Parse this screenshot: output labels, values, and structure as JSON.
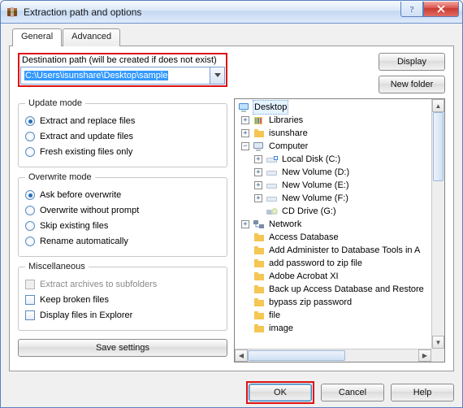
{
  "window": {
    "title": "Extraction path and options"
  },
  "tabs": {
    "general": "General",
    "advanced": "Advanced"
  },
  "dest": {
    "label": "Destination path (will be created if does not exist)",
    "value": "C:\\Users\\isunshare\\Desktop\\sample"
  },
  "buttons": {
    "display": "Display",
    "newfolder": "New folder",
    "save": "Save settings",
    "ok": "OK",
    "cancel": "Cancel",
    "help": "Help"
  },
  "update": {
    "legend": "Update mode",
    "opt1": "Extract and replace files",
    "opt2": "Extract and update files",
    "opt3": "Fresh existing files only"
  },
  "overwrite": {
    "legend": "Overwrite mode",
    "opt1": "Ask before overwrite",
    "opt2": "Overwrite without prompt",
    "opt3": "Skip existing files",
    "opt4": "Rename automatically"
  },
  "misc": {
    "legend": "Miscellaneous",
    "opt1": "Extract archives to subfolders",
    "opt2": "Keep broken files",
    "opt3": "Display files in Explorer"
  },
  "tree": {
    "desktop": "Desktop",
    "libraries": "Libraries",
    "user": "isunshare",
    "computer": "Computer",
    "localdisk": "Local Disk (C:)",
    "vold": "New Volume (D:)",
    "vole": "New Volume (E:)",
    "volf": "New Volume (F:)",
    "cdg": "CD Drive (G:)",
    "network": "Network",
    "f1": "Access Database",
    "f2": "Add Administer to Database Tools in A",
    "f3": "add password  to zip file",
    "f4": "Adobe Acrobat XI",
    "f5": "Back up Access Database and Restore",
    "f6": "bypass zip password",
    "f7": "file",
    "f8": "image"
  }
}
